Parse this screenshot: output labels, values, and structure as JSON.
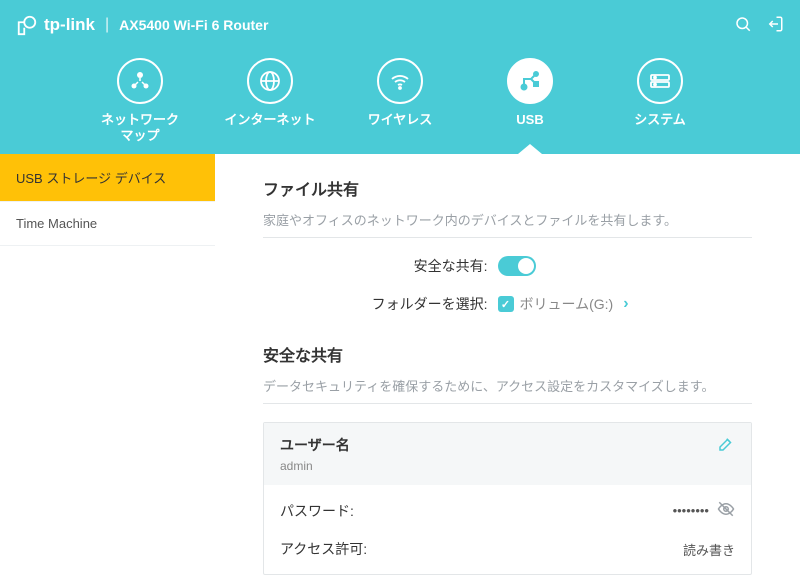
{
  "header": {
    "brand": "tp-link",
    "model": "AX5400 Wi-Fi 6 Router"
  },
  "nav": {
    "items": [
      {
        "id": "network-map",
        "label": "ネットワーク\nマップ"
      },
      {
        "id": "internet",
        "label": "インターネット"
      },
      {
        "id": "wireless",
        "label": "ワイヤレス"
      },
      {
        "id": "usb",
        "label": "USB"
      },
      {
        "id": "system",
        "label": "システム"
      }
    ],
    "active": "usb"
  },
  "sidebar": {
    "items": [
      {
        "id": "usb-storage",
        "label": "USB ストレージ デバイス"
      },
      {
        "id": "time-machine",
        "label": "Time Machine"
      }
    ],
    "active": "usb-storage"
  },
  "main": {
    "file_sharing": {
      "title": "ファイル共有",
      "desc": "家庭やオフィスのネットワーク内のデバイスとファイルを共有します。",
      "secure_share_label": "安全な共有:",
      "secure_share_on": true,
      "folder_label": "フォルダーを選択:",
      "folder_value": "ボリューム(G:)"
    },
    "secure_sharing": {
      "title": "安全な共有",
      "desc": "データセキュリティを確保するために、アクセス設定をカスタマイズします。",
      "card": {
        "username_label": "ユーザー名",
        "username": "admin",
        "password_label": "パスワード:",
        "password_masked": "••••••••",
        "permission_label": "アクセス許可:",
        "permission_value": "読み書き"
      }
    }
  }
}
